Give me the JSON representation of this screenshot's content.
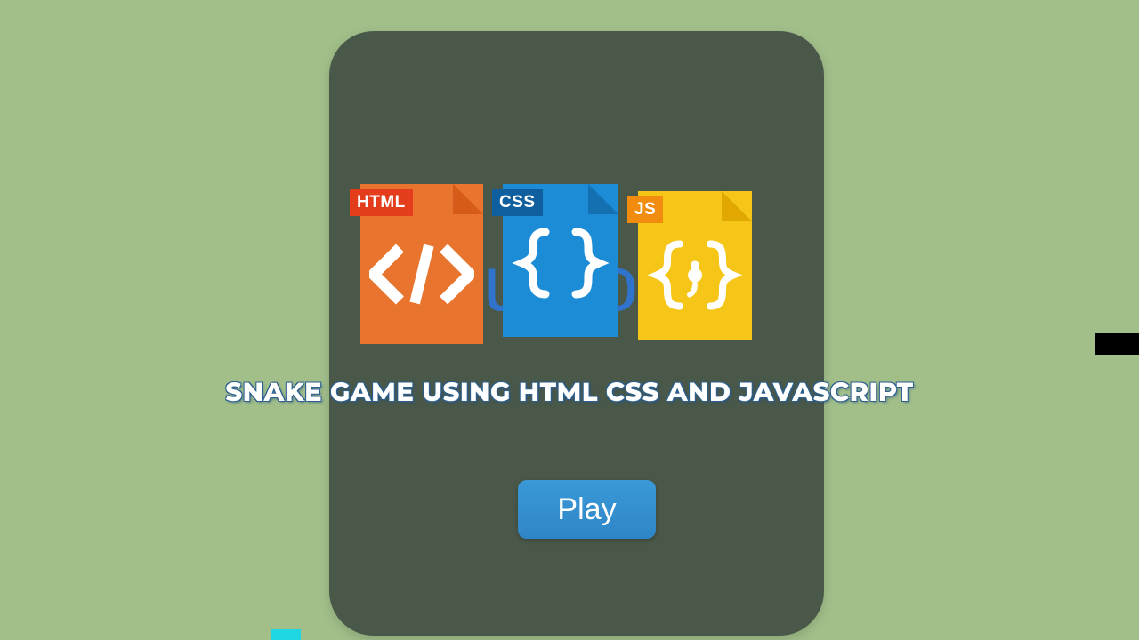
{
  "background_text": "You Lose!",
  "heading": "SNAKE GAME USING HTML CSS AND JAVASCRIPT",
  "play_button": {
    "label": "Play"
  },
  "icons": {
    "html": {
      "tab": "HTML"
    },
    "css": {
      "tab": "CSS"
    },
    "js": {
      "tab": "JS"
    }
  },
  "colors": {
    "page_bg": "#a2bf8a",
    "card_bg": "#495849",
    "button_bg": "#3a99d8",
    "accent_cyan": "#1fd6e3"
  }
}
